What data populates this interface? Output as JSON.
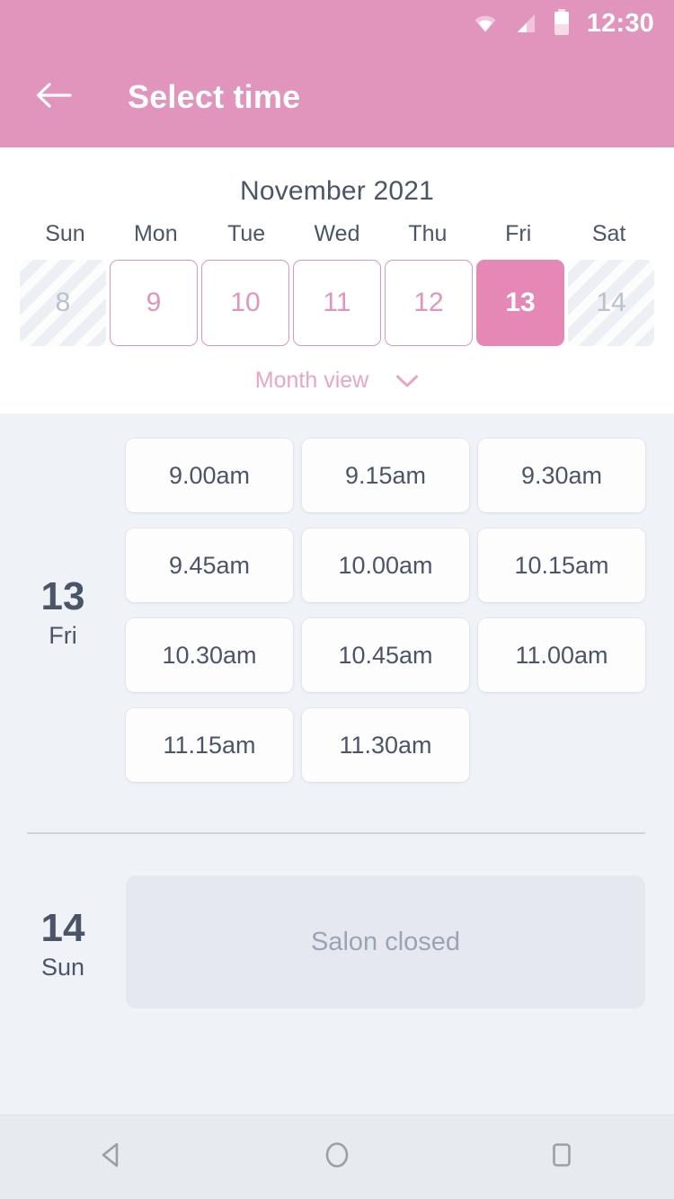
{
  "status_bar": {
    "time": "12:30",
    "icons": [
      "wifi-icon",
      "signal-icon",
      "battery-icon"
    ]
  },
  "app_bar": {
    "back_icon": "arrow-left-icon",
    "title": "Select time"
  },
  "calendar": {
    "month_title": "November 2021",
    "weekday_labels": [
      "Sun",
      "Mon",
      "Tue",
      "Wed",
      "Thu",
      "Fri",
      "Sat"
    ],
    "days": [
      {
        "num": "8",
        "state": "disabled"
      },
      {
        "num": "9",
        "state": "available"
      },
      {
        "num": "10",
        "state": "available"
      },
      {
        "num": "11",
        "state": "available"
      },
      {
        "num": "12",
        "state": "available"
      },
      {
        "num": "13",
        "state": "selected"
      },
      {
        "num": "14",
        "state": "disabled"
      }
    ],
    "month_view_label": "Month view",
    "month_view_chevron": "chevron-down-icon"
  },
  "schedule": [
    {
      "day_number": "13",
      "day_name": "Fri",
      "slots": [
        "9.00am",
        "9.15am",
        "9.30am",
        "9.45am",
        "10.00am",
        "10.15am",
        "10.30am",
        "10.45am",
        "11.00am",
        "11.15am",
        "11.30am"
      ],
      "closed_message": null
    },
    {
      "day_number": "14",
      "day_name": "Sun",
      "slots": [],
      "closed_message": "Salon closed"
    }
  ],
  "nav_bar": {
    "back": "triangle-back-icon",
    "home": "circle-home-icon",
    "recents": "square-recents-icon"
  },
  "colors": {
    "brand_pink": "#e195bc",
    "selected_pink": "#e588b5",
    "page_bg": "#eff2f7",
    "text_slate": "#4b5568"
  }
}
